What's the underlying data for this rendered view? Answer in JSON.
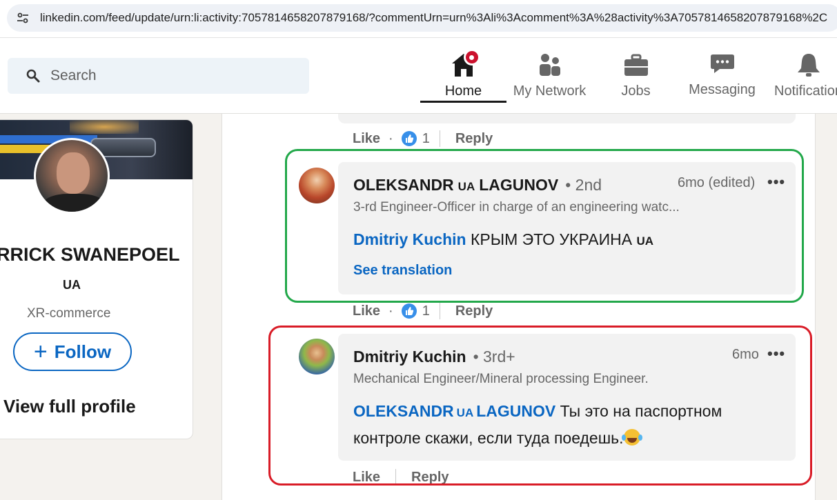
{
  "browser": {
    "url": "linkedin.com/feed/update/urn:li:activity:7057814658207879168/?commentUrn=urn%3Ali%3Acomment%3A%28activity%3A7057814658207879168%2C"
  },
  "header": {
    "search_placeholder": "Search",
    "nav": [
      {
        "label": "Home",
        "icon": "home-icon",
        "active": true
      },
      {
        "label": "My Network",
        "icon": "network-icon"
      },
      {
        "label": "Jobs",
        "icon": "briefcase-icon"
      },
      {
        "label": "Messaging",
        "icon": "messaging-icon"
      },
      {
        "label": "Notification",
        "icon": "bell-icon"
      }
    ]
  },
  "profile": {
    "name": "RRICK SWANEPOEL",
    "flag": "UA",
    "headline": "XR-commerce",
    "follow_label": "Follow",
    "view_full_profile": "View full profile"
  },
  "prev_actions": {
    "like": "Like",
    "like_count": "1",
    "reply": "Reply"
  },
  "comments": [
    {
      "author_first": "OLEKSANDR",
      "author_flag": "UA",
      "author_last": "LAGUNOV",
      "degree": "• 2nd",
      "time": "6mo (edited)",
      "more": "•••",
      "headline": "3-rd Engineer-Officer in charge of an engineering watc...",
      "mention": "Dmitriy Kuchin",
      "text": "КРЫМ ЭТО УКРАИНА",
      "text_flag": "UA",
      "see_translation": "See translation",
      "actions": {
        "like": "Like",
        "like_count": "1",
        "reply": "Reply"
      },
      "highlight": "#22a84a"
    },
    {
      "author": "Dmitriy Kuchin",
      "degree": "• 3rd+",
      "time": "6mo",
      "more": "•••",
      "headline": "Mechanical Engineer/Mineral processing Engineer.",
      "mention_first": "OLEKSANDR",
      "mention_flag": "UA",
      "mention_last": "LAGUNOV",
      "text_line1": "Ты это на паспортном",
      "text_line2": "контроле скажи, если туда поедешь.",
      "emoji": "laughing-tears-emoji",
      "actions": {
        "like": "Like",
        "reply": "Reply"
      },
      "highlight": "#d91c27"
    }
  ],
  "colors": {
    "linkedin_blue": "#0a66c2",
    "notification_red": "#cb112d",
    "green_highlight": "#22a84a",
    "red_highlight": "#d91c27"
  }
}
